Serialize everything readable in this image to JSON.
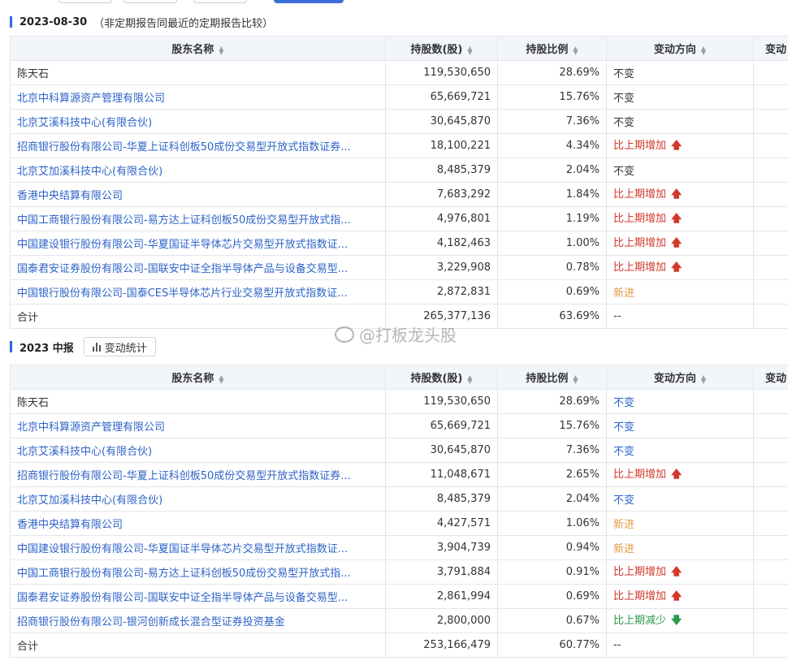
{
  "section1": {
    "title": "2023-08-30",
    "note": "（非定期报告同最近的定期报告比较）",
    "headers": [
      "股东名称",
      "持股数(股)",
      "持股比例",
      "变动方向",
      "变动"
    ],
    "rows": [
      {
        "name": "陈天石",
        "shares": "119,530,650",
        "ratio": "28.69%",
        "dir": "不变",
        "type": "nochange",
        "link": false
      },
      {
        "name": "北京中科算源资产管理有限公司",
        "shares": "65,669,721",
        "ratio": "15.76%",
        "dir": "不变",
        "type": "nochange",
        "link": true
      },
      {
        "name": "北京艾溪科技中心(有限合伙)",
        "shares": "30,645,870",
        "ratio": "7.36%",
        "dir": "不变",
        "type": "nochange",
        "link": true
      },
      {
        "name": "招商银行股份有限公司-华夏上证科创板50成份交易型开放式指数证券...",
        "shares": "18,100,221",
        "ratio": "4.34%",
        "dir": "比上期增加",
        "type": "up",
        "link": true
      },
      {
        "name": "北京艾加溪科技中心(有限合伙)",
        "shares": "8,485,379",
        "ratio": "2.04%",
        "dir": "不变",
        "type": "nochange",
        "link": true
      },
      {
        "name": "香港中央结算有限公司",
        "shares": "7,683,292",
        "ratio": "1.84%",
        "dir": "比上期增加",
        "type": "up",
        "link": true
      },
      {
        "name": "中国工商银行股份有限公司-易方达上证科创板50成份交易型开放式指...",
        "shares": "4,976,801",
        "ratio": "1.19%",
        "dir": "比上期增加",
        "type": "up",
        "link": true
      },
      {
        "name": "中国建设银行股份有限公司-华夏国证半导体芯片交易型开放式指数证...",
        "shares": "4,182,463",
        "ratio": "1.00%",
        "dir": "比上期增加",
        "type": "up",
        "link": true
      },
      {
        "name": "国泰君安证券股份有限公司-国联安中证全指半导体产品与设备交易型...",
        "shares": "3,229,908",
        "ratio": "0.78%",
        "dir": "比上期增加",
        "type": "up",
        "link": true
      },
      {
        "name": "中国银行股份有限公司-国泰CES半导体芯片行业交易型开放式指数证...",
        "shares": "2,872,831",
        "ratio": "0.69%",
        "dir": "新进",
        "type": "new",
        "link": true
      },
      {
        "name": "合计",
        "shares": "265,377,136",
        "ratio": "63.69%",
        "dir": "--",
        "type": "nochange",
        "link": false
      }
    ]
  },
  "section2": {
    "title": "2023 中报",
    "button": "变动统计",
    "headers": [
      "股东名称",
      "持股数(股)",
      "持股比例",
      "变动方向",
      "变动"
    ],
    "rows": [
      {
        "name": "陈天石",
        "shares": "119,530,650",
        "ratio": "28.69%",
        "dir": "不变",
        "type": "nochange-blue",
        "link": false
      },
      {
        "name": "北京中科算源资产管理有限公司",
        "shares": "65,669,721",
        "ratio": "15.76%",
        "dir": "不变",
        "type": "nochange-blue",
        "link": true
      },
      {
        "name": "北京艾溪科技中心(有限合伙)",
        "shares": "30,645,870",
        "ratio": "7.36%",
        "dir": "不变",
        "type": "nochange-blue",
        "link": true
      },
      {
        "name": "招商银行股份有限公司-华夏上证科创板50成份交易型开放式指数证券...",
        "shares": "11,048,671",
        "ratio": "2.65%",
        "dir": "比上期增加",
        "type": "up",
        "link": true
      },
      {
        "name": "北京艾加溪科技中心(有限合伙)",
        "shares": "8,485,379",
        "ratio": "2.04%",
        "dir": "不变",
        "type": "nochange-blue",
        "link": true
      },
      {
        "name": "香港中央结算有限公司",
        "shares": "4,427,571",
        "ratio": "1.06%",
        "dir": "新进",
        "type": "new",
        "link": true
      },
      {
        "name": "中国建设银行股份有限公司-华夏国证半导体芯片交易型开放式指数证...",
        "shares": "3,904,739",
        "ratio": "0.94%",
        "dir": "新进",
        "type": "new",
        "link": true
      },
      {
        "name": "中国工商银行股份有限公司-易方达上证科创板50成份交易型开放式指...",
        "shares": "3,791,884",
        "ratio": "0.91%",
        "dir": "比上期增加",
        "type": "up",
        "link": true
      },
      {
        "name": "国泰君安证券股份有限公司-国联安中证全指半导体产品与设备交易型...",
        "shares": "2,861,994",
        "ratio": "0.69%",
        "dir": "比上期增加",
        "type": "up",
        "link": true
      },
      {
        "name": "招商银行股份有限公司-银河创新成长混合型证券投资基金",
        "shares": "2,800,000",
        "ratio": "0.67%",
        "dir": "比上期减少",
        "type": "down",
        "link": true
      },
      {
        "name": "合计",
        "shares": "253,166,479",
        "ratio": "60.77%",
        "dir": "--",
        "type": "nochange",
        "link": false
      }
    ]
  },
  "watermark": "@打板龙头股",
  "arrows": {
    "up": "🡅",
    "down": "🡇"
  },
  "colors": {
    "accent": "#2f6cd6",
    "link": "#2d63c8",
    "up": "#d2382b",
    "new": "#e39a44",
    "down": "#2a9a4b"
  }
}
